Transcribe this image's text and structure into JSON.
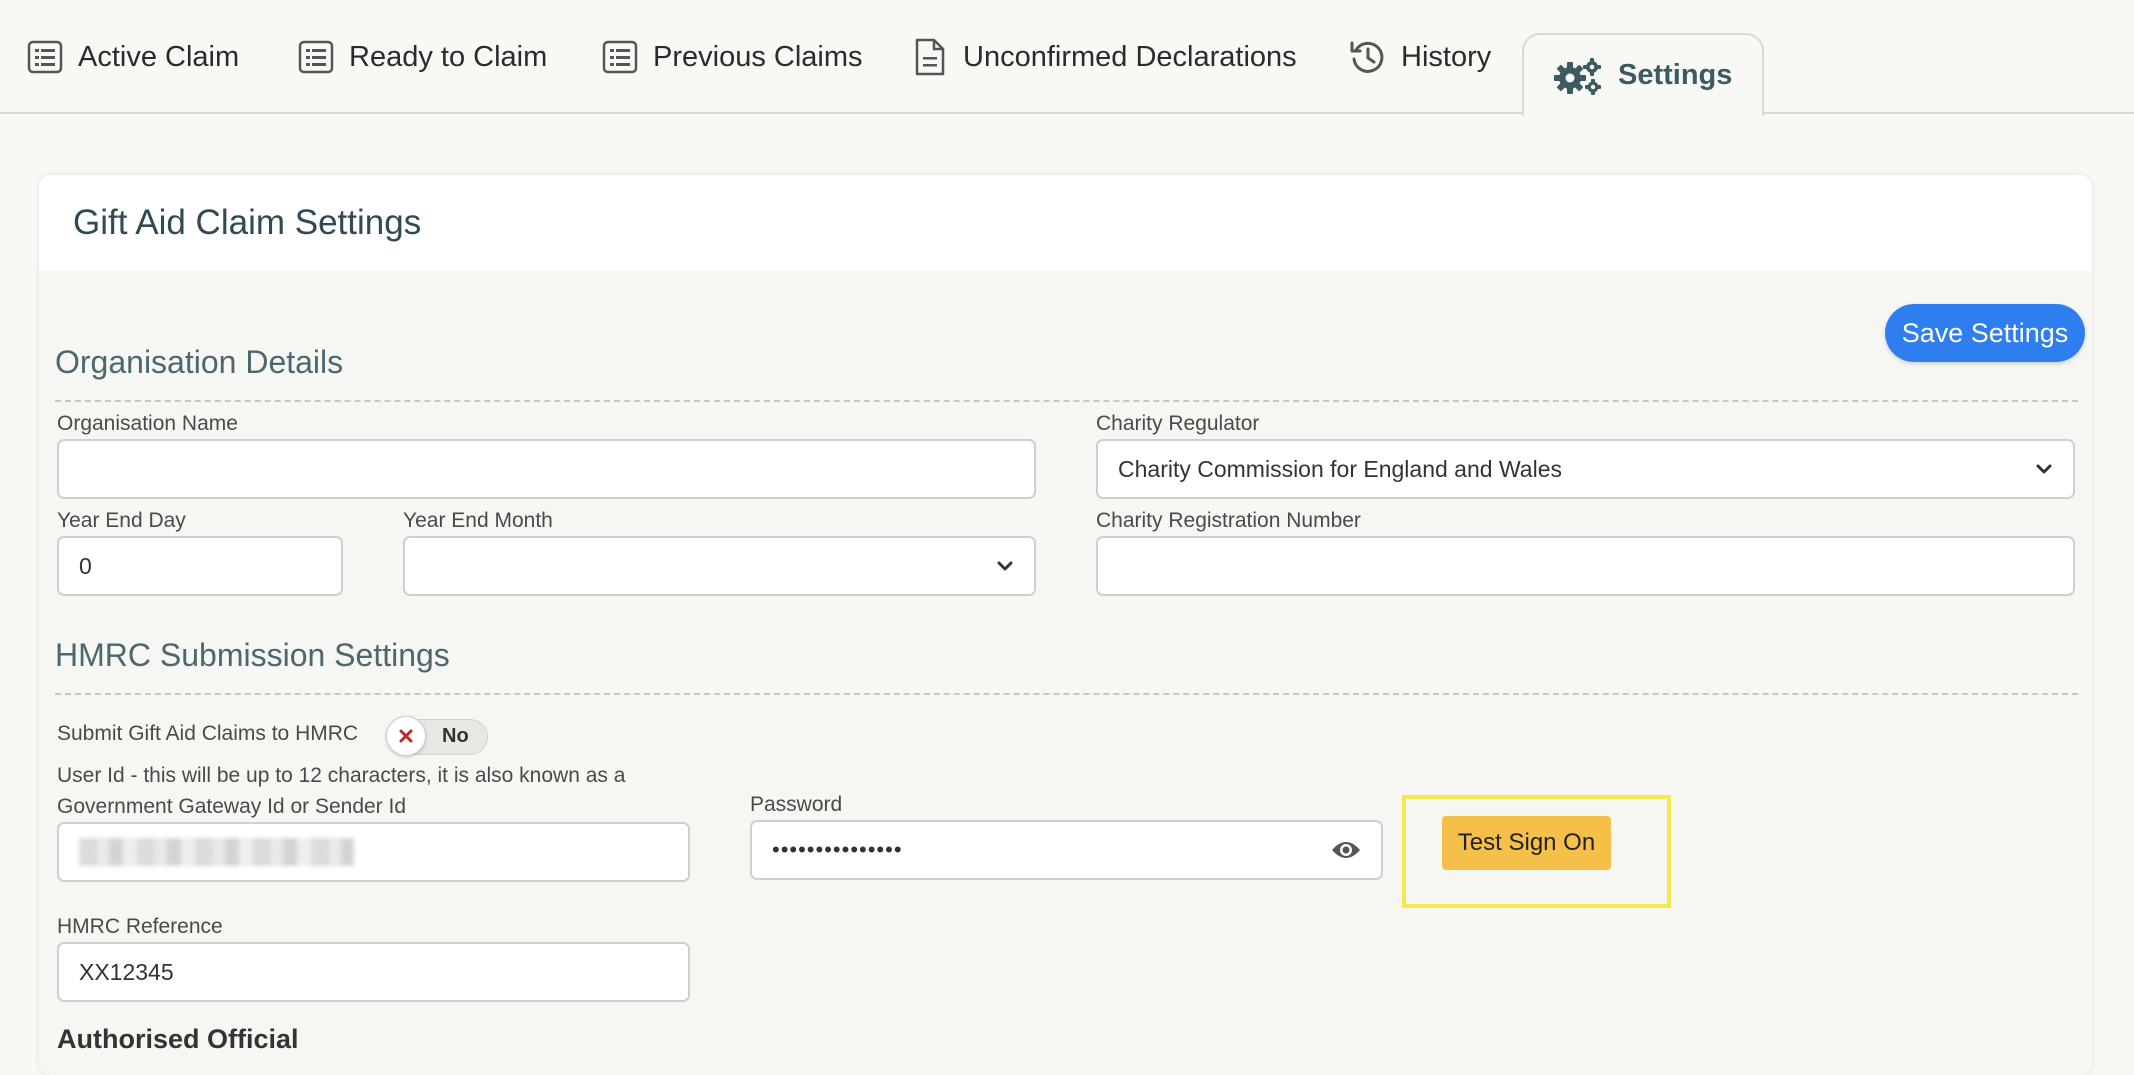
{
  "tabs": [
    {
      "label": "Active Claim",
      "icon": "list-icon"
    },
    {
      "label": "Ready to Claim",
      "icon": "list-icon"
    },
    {
      "label": "Previous Claims",
      "icon": "list-icon"
    },
    {
      "label": "Unconfirmed Declarations",
      "icon": "document-icon"
    },
    {
      "label": "History",
      "icon": "history-icon"
    },
    {
      "label": "Settings",
      "icon": "gears-icon",
      "active": true
    }
  ],
  "card": {
    "title": "Gift Aid Claim Settings",
    "save_label": "Save Settings"
  },
  "organisation": {
    "section_title": "Organisation Details",
    "name_label": "Organisation Name",
    "name_value": "",
    "regulator_label": "Charity Regulator",
    "regulator_value": "Charity Commission for England and Wales",
    "year_end_day_label": "Year End Day",
    "year_end_day_value": "0",
    "year_end_month_label": "Year End Month",
    "year_end_month_value": "",
    "reg_number_label": "Charity Registration Number",
    "reg_number_value": ""
  },
  "hmrc": {
    "section_title": "HMRC Submission Settings",
    "submit_label": "Submit Gift Aid Claims to HMRC",
    "submit_toggle_text": "No",
    "user_id_label": "User Id - this will be up to 12 characters, it is also known as a Government Gateway Id or Sender Id",
    "password_label": "Password",
    "password_value": "•••••••••••••••",
    "test_button_label": "Test Sign On",
    "reference_label": "HMRC Reference",
    "reference_value": "XX12345",
    "authorised_official_heading": "Authorised Official"
  },
  "colors": {
    "accent_blue": "#2f7ef0",
    "test_button": "#f4c04a",
    "highlight": "#f5e94b",
    "toggle_off": "#c0262d"
  }
}
